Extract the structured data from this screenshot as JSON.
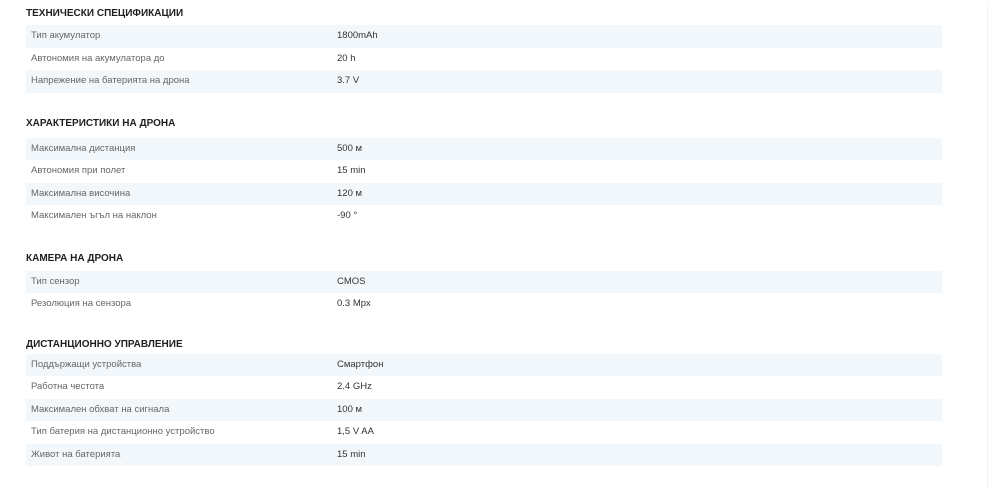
{
  "sections": [
    {
      "title": "ТЕХНИЧЕСКИ СПЕЦИФИКАЦИИ",
      "rows": [
        {
          "label": "Тип акумулатор",
          "value": "1800mAh"
        },
        {
          "label": "Автономия на акумулатора до",
          "value": "20 h"
        },
        {
          "label": "Напрежение на батерията на дрона",
          "value": "3.7 V"
        }
      ]
    },
    {
      "title": "ХАРАКТЕРИСТИКИ НА ДРОНА",
      "rows": [
        {
          "label": "Максимална дистанция",
          "value": "500 м"
        },
        {
          "label": "Автономия при полет",
          "value": "15 min"
        },
        {
          "label": "Максимална височина",
          "value": "120 м"
        },
        {
          "label": "Максимален ъгъл на наклон",
          "value": "-90 °"
        }
      ]
    },
    {
      "title": "КАМЕРА НА ДРОНА",
      "rows": [
        {
          "label": "Тип сензор",
          "value": "CMOS"
        },
        {
          "label": "Резолюция на сензора",
          "value": "0.3 Mpx"
        }
      ]
    },
    {
      "title": "ДИСТАНЦИОННО УПРАВЛЕНИЕ",
      "rows": [
        {
          "label": "Поддържащи устройства",
          "value": "Смартфон"
        },
        {
          "label": "Работна честота",
          "value": "2.4 GHz"
        },
        {
          "label": "Максимален обхват на сигнала",
          "value": "100 м"
        },
        {
          "label": "Тип батерия на дистанционно устройство",
          "value": "1,5 V AA"
        },
        {
          "label": "Живот на батерията",
          "value": "15 min"
        }
      ]
    }
  ]
}
